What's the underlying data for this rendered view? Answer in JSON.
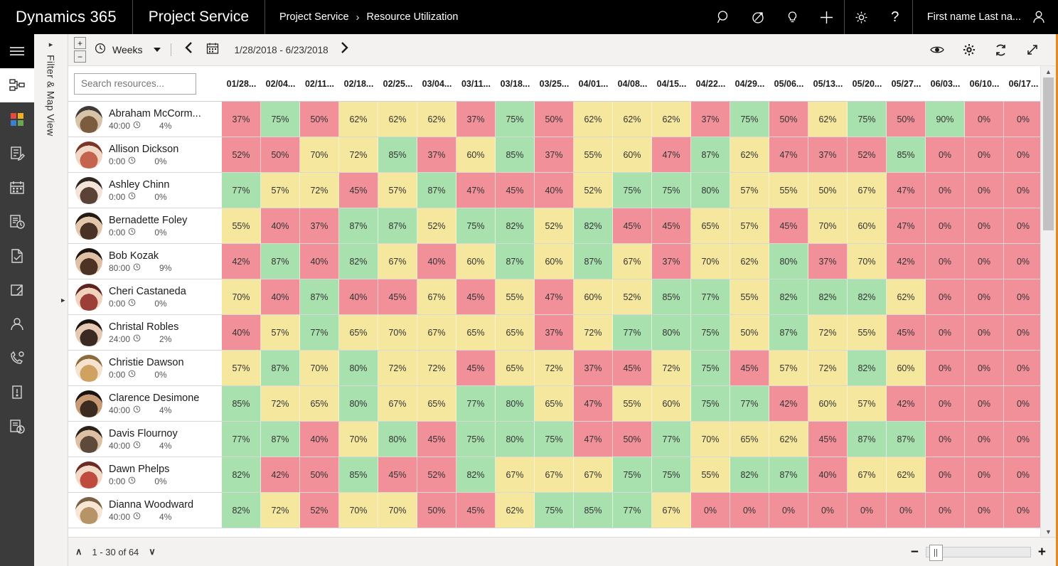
{
  "topbar": {
    "brand": "Dynamics 365",
    "app": "Project Service",
    "breadcrumb_root": "Project Service",
    "breadcrumb_sep": "›",
    "breadcrumb_current": "Resource Utilization",
    "user_name": "First name Last na...",
    "icons": [
      "search-icon",
      "assistant-icon",
      "insights-icon",
      "add-icon",
      "settings-icon",
      "help-icon",
      "user-avatar-icon"
    ]
  },
  "rail": {
    "items": [
      {
        "name": "hamburger-menu-icon",
        "label": "Menu"
      },
      {
        "name": "sitemap-icon",
        "label": "Site Map"
      },
      {
        "name": "dashboard-icon",
        "label": "Dashboards"
      },
      {
        "name": "edit-form-icon",
        "label": "Activities"
      },
      {
        "name": "calendar-icon",
        "label": "Calendar"
      },
      {
        "name": "document-clock-icon",
        "label": "Schedule Board"
      },
      {
        "name": "document-check-icon",
        "label": "Approvals"
      },
      {
        "name": "folder-arrow-icon",
        "label": "Projects"
      },
      {
        "name": "person-icon",
        "label": "Resources"
      },
      {
        "name": "phone-gear-icon",
        "label": "Service"
      },
      {
        "name": "alert-icon",
        "label": "Alerts"
      },
      {
        "name": "report-clock-icon",
        "label": "Reports"
      }
    ]
  },
  "filter_panel": {
    "title": "Filter & Map View",
    "expand_caret": "▸"
  },
  "toolbar": {
    "expand_label": "+",
    "collapse_label": "−",
    "scale_label": "Weeks",
    "clock_icon": "clock-icon",
    "prev_label": "‹",
    "next_label": "›",
    "calendar_icon": "calendar-icon",
    "date_range": "1/28/2018 - 6/23/2018",
    "right_icons": [
      "eye-icon",
      "gear-icon",
      "refresh-icon",
      "fullscreen-icon"
    ]
  },
  "grid": {
    "search_placeholder": "Search resources...",
    "columns": [
      "01/28...",
      "02/04...",
      "02/11...",
      "02/18...",
      "02/25...",
      "03/04...",
      "03/11...",
      "03/18...",
      "03/25...",
      "04/01...",
      "04/08...",
      "04/15...",
      "04/22...",
      "04/29...",
      "05/06...",
      "05/13...",
      "05/20...",
      "05/27...",
      "06/03...",
      "06/10...",
      "06/17..."
    ],
    "colors": {
      "red": "#F2909A",
      "yellow": "#F5E79E",
      "green": "#A8E0AE"
    },
    "rows": [
      {
        "name": "Abraham McCorm...",
        "hours": "40:00",
        "pct": "4%",
        "avatar": "photo-man-young",
        "values": [
          "37%",
          "75%",
          "50%",
          "62%",
          "62%",
          "62%",
          "37%",
          "75%",
          "50%",
          "62%",
          "62%",
          "62%",
          "37%",
          "75%",
          "50%",
          "62%",
          "75%",
          "50%",
          "90%",
          "0%",
          "0%"
        ],
        "colors": [
          "red",
          "green",
          "red",
          "yellow",
          "yellow",
          "yellow",
          "red",
          "green",
          "red",
          "yellow",
          "yellow",
          "yellow",
          "red",
          "green",
          "red",
          "yellow",
          "green",
          "red",
          "green",
          "red",
          "red"
        ]
      },
      {
        "name": "Allison Dickson",
        "hours": "0:00",
        "pct": "0%",
        "avatar": "photo-woman-red",
        "values": [
          "52%",
          "50%",
          "70%",
          "72%",
          "85%",
          "37%",
          "60%",
          "85%",
          "37%",
          "55%",
          "60%",
          "47%",
          "87%",
          "62%",
          "47%",
          "37%",
          "52%",
          "85%",
          "0%",
          "0%",
          "0%"
        ],
        "colors": [
          "red",
          "red",
          "yellow",
          "yellow",
          "green",
          "red",
          "yellow",
          "green",
          "red",
          "yellow",
          "yellow",
          "red",
          "green",
          "yellow",
          "red",
          "red",
          "red",
          "green",
          "red",
          "red",
          "red"
        ]
      },
      {
        "name": "Ashley Chinn",
        "hours": "0:00",
        "pct": "0%",
        "avatar": "photo-woman-asian",
        "values": [
          "77%",
          "57%",
          "72%",
          "45%",
          "57%",
          "87%",
          "47%",
          "45%",
          "40%",
          "52%",
          "75%",
          "75%",
          "80%",
          "57%",
          "55%",
          "50%",
          "67%",
          "47%",
          "0%",
          "0%",
          "0%"
        ],
        "colors": [
          "green",
          "yellow",
          "yellow",
          "red",
          "yellow",
          "green",
          "red",
          "red",
          "red",
          "yellow",
          "green",
          "green",
          "green",
          "yellow",
          "yellow",
          "yellow",
          "yellow",
          "red",
          "red",
          "red",
          "red"
        ]
      },
      {
        "name": "Bernadette Foley",
        "hours": "0:00",
        "pct": "0%",
        "avatar": "photo-woman-curly",
        "values": [
          "55%",
          "40%",
          "37%",
          "87%",
          "87%",
          "52%",
          "75%",
          "82%",
          "52%",
          "82%",
          "45%",
          "45%",
          "65%",
          "57%",
          "45%",
          "70%",
          "60%",
          "47%",
          "0%",
          "0%",
          "0%"
        ],
        "colors": [
          "yellow",
          "red",
          "red",
          "green",
          "green",
          "yellow",
          "green",
          "green",
          "yellow",
          "green",
          "red",
          "red",
          "yellow",
          "yellow",
          "red",
          "yellow",
          "yellow",
          "red",
          "red",
          "red",
          "red"
        ]
      },
      {
        "name": "Bob Kozak",
        "hours": "80:00",
        "pct": "9%",
        "avatar": "photo-man-beard",
        "values": [
          "42%",
          "87%",
          "40%",
          "82%",
          "67%",
          "40%",
          "60%",
          "87%",
          "60%",
          "87%",
          "67%",
          "37%",
          "70%",
          "62%",
          "80%",
          "37%",
          "70%",
          "42%",
          "0%",
          "0%",
          "0%"
        ],
        "colors": [
          "red",
          "green",
          "red",
          "green",
          "yellow",
          "red",
          "yellow",
          "green",
          "yellow",
          "green",
          "yellow",
          "red",
          "yellow",
          "yellow",
          "green",
          "red",
          "yellow",
          "red",
          "red",
          "red",
          "red"
        ]
      },
      {
        "name": "Cheri Castaneda",
        "hours": "0:00",
        "pct": "0%",
        "avatar": "photo-woman-smile",
        "values": [
          "70%",
          "40%",
          "87%",
          "40%",
          "45%",
          "67%",
          "45%",
          "55%",
          "47%",
          "60%",
          "52%",
          "85%",
          "77%",
          "55%",
          "82%",
          "82%",
          "82%",
          "62%",
          "0%",
          "0%",
          "0%"
        ],
        "colors": [
          "yellow",
          "red",
          "green",
          "red",
          "red",
          "yellow",
          "red",
          "yellow",
          "red",
          "yellow",
          "yellow",
          "green",
          "green",
          "yellow",
          "green",
          "green",
          "green",
          "yellow",
          "red",
          "red",
          "red"
        ]
      },
      {
        "name": "Christal Robles",
        "hours": "24:00",
        "pct": "2%",
        "avatar": "photo-woman-dark",
        "values": [
          "40%",
          "57%",
          "77%",
          "65%",
          "70%",
          "67%",
          "65%",
          "65%",
          "37%",
          "72%",
          "77%",
          "80%",
          "75%",
          "50%",
          "87%",
          "72%",
          "55%",
          "45%",
          "0%",
          "0%",
          "0%"
        ],
        "colors": [
          "red",
          "yellow",
          "green",
          "yellow",
          "yellow",
          "yellow",
          "yellow",
          "yellow",
          "red",
          "yellow",
          "green",
          "green",
          "green",
          "yellow",
          "green",
          "yellow",
          "yellow",
          "red",
          "red",
          "red",
          "red"
        ]
      },
      {
        "name": "Christie Dawson",
        "hours": "0:00",
        "pct": "0%",
        "avatar": "photo-woman-blonde",
        "values": [
          "57%",
          "87%",
          "70%",
          "80%",
          "72%",
          "72%",
          "45%",
          "65%",
          "72%",
          "37%",
          "45%",
          "72%",
          "75%",
          "45%",
          "57%",
          "72%",
          "82%",
          "60%",
          "0%",
          "0%",
          "0%"
        ],
        "colors": [
          "yellow",
          "green",
          "yellow",
          "green",
          "yellow",
          "yellow",
          "red",
          "yellow",
          "yellow",
          "red",
          "red",
          "yellow",
          "green",
          "red",
          "yellow",
          "yellow",
          "green",
          "yellow",
          "red",
          "red",
          "red"
        ]
      },
      {
        "name": "Clarence Desimone",
        "hours": "40:00",
        "pct": "4%",
        "avatar": "photo-man-dark",
        "values": [
          "85%",
          "72%",
          "65%",
          "80%",
          "67%",
          "65%",
          "77%",
          "80%",
          "65%",
          "47%",
          "55%",
          "60%",
          "75%",
          "77%",
          "42%",
          "60%",
          "57%",
          "42%",
          "0%",
          "0%",
          "0%"
        ],
        "colors": [
          "green",
          "yellow",
          "yellow",
          "green",
          "yellow",
          "yellow",
          "green",
          "green",
          "yellow",
          "red",
          "yellow",
          "yellow",
          "green",
          "green",
          "red",
          "yellow",
          "yellow",
          "red",
          "red",
          "red",
          "red"
        ]
      },
      {
        "name": "Davis Flournoy",
        "hours": "40:00",
        "pct": "4%",
        "avatar": "photo-man-glasses",
        "values": [
          "77%",
          "87%",
          "40%",
          "70%",
          "80%",
          "45%",
          "75%",
          "80%",
          "75%",
          "47%",
          "50%",
          "77%",
          "70%",
          "65%",
          "62%",
          "45%",
          "87%",
          "87%",
          "0%",
          "0%",
          "0%"
        ],
        "colors": [
          "green",
          "green",
          "red",
          "yellow",
          "green",
          "red",
          "green",
          "green",
          "green",
          "red",
          "red",
          "green",
          "yellow",
          "yellow",
          "yellow",
          "red",
          "green",
          "green",
          "red",
          "red",
          "red"
        ]
      },
      {
        "name": "Dawn Phelps",
        "hours": "0:00",
        "pct": "0%",
        "avatar": "photo-woman-red2",
        "values": [
          "82%",
          "42%",
          "50%",
          "85%",
          "45%",
          "52%",
          "82%",
          "67%",
          "67%",
          "67%",
          "75%",
          "75%",
          "55%",
          "82%",
          "87%",
          "40%",
          "67%",
          "62%",
          "0%",
          "0%",
          "0%"
        ],
        "colors": [
          "green",
          "red",
          "red",
          "green",
          "red",
          "red",
          "green",
          "yellow",
          "yellow",
          "yellow",
          "green",
          "green",
          "yellow",
          "green",
          "green",
          "red",
          "yellow",
          "yellow",
          "red",
          "red",
          "red"
        ]
      },
      {
        "name": "Dianna Woodward",
        "hours": "40:00",
        "pct": "4%",
        "avatar": "photo-woman-fair",
        "values": [
          "82%",
          "72%",
          "52%",
          "70%",
          "70%",
          "50%",
          "45%",
          "62%",
          "75%",
          "85%",
          "77%",
          "67%",
          "0%",
          "0%",
          "0%",
          "0%",
          "0%",
          "0%",
          "0%",
          "0%",
          "0%"
        ],
        "colors": [
          "green",
          "yellow",
          "red",
          "yellow",
          "yellow",
          "red",
          "red",
          "yellow",
          "green",
          "green",
          "green",
          "yellow",
          "red",
          "red",
          "red",
          "red",
          "red",
          "red",
          "red",
          "red",
          "red"
        ]
      }
    ]
  },
  "footer": {
    "page_up": "∧",
    "page_down": "∨",
    "range_text": "1 - 30 of 64",
    "zoom_out": "−",
    "zoom_in": "+"
  }
}
